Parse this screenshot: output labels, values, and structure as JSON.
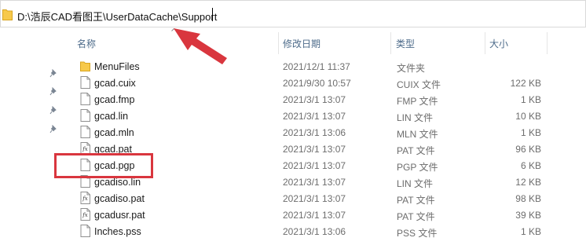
{
  "address": {
    "path": "D:\\浩辰CAD看图王\\UserDataCache\\Support"
  },
  "columns": {
    "name": "名称",
    "date": "修改日期",
    "type": "类型",
    "size": "大小"
  },
  "files": [
    {
      "name": "MenuFiles",
      "date": "2021/12/1 11:37",
      "type": "文件夹",
      "size": "",
      "icon": "folder-icon"
    },
    {
      "name": "gcad.cuix",
      "date": "2021/9/30 10:57",
      "type": "CUIX 文件",
      "size": "122 KB",
      "icon": "file-icon"
    },
    {
      "name": "gcad.fmp",
      "date": "2021/3/1 13:07",
      "type": "FMP 文件",
      "size": "1 KB",
      "icon": "file-icon"
    },
    {
      "name": "gcad.lin",
      "date": "2021/3/1 13:07",
      "type": "LIN 文件",
      "size": "10 KB",
      "icon": "file-icon"
    },
    {
      "name": "gcad.mln",
      "date": "2021/3/1 13:06",
      "type": "MLN 文件",
      "size": "1 KB",
      "icon": "file-icon"
    },
    {
      "name": "gcad.pat",
      "date": "2021/3/1 13:07",
      "type": "PAT 文件",
      "size": "96 KB",
      "icon": "pattern-file-icon"
    },
    {
      "name": "gcad.pgp",
      "date": "2021/3/1 13:07",
      "type": "PGP 文件",
      "size": "6 KB",
      "icon": "file-icon"
    },
    {
      "name": "gcadiso.lin",
      "date": "2021/3/1 13:07",
      "type": "LIN 文件",
      "size": "12 KB",
      "icon": "file-icon"
    },
    {
      "name": "gcadiso.pat",
      "date": "2021/3/1 13:07",
      "type": "PAT 文件",
      "size": "98 KB",
      "icon": "pattern-file-icon"
    },
    {
      "name": "gcadusr.pat",
      "date": "2021/3/1 13:07",
      "type": "PAT 文件",
      "size": "39 KB",
      "icon": "pattern-file-icon"
    },
    {
      "name": "Inches.pss",
      "date": "2021/3/1 13:06",
      "type": "PSS 文件",
      "size": "1 KB",
      "icon": "file-icon"
    }
  ],
  "pins": [
    "pin-icon",
    "pin-icon",
    "pin-icon",
    "pin-icon"
  ],
  "colors": {
    "annotation": "#d9363e",
    "header_text": "#4d6b8a",
    "folder": "#f7c94b"
  }
}
